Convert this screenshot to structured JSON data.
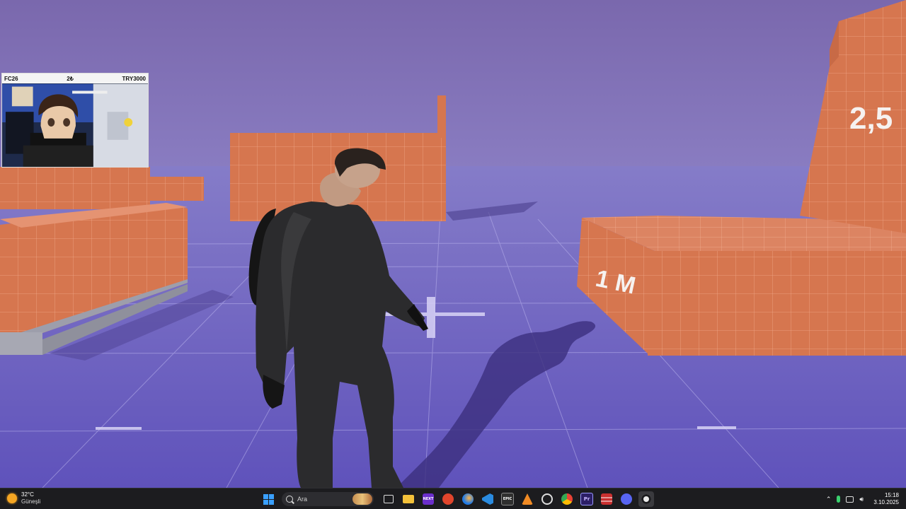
{
  "scene": {
    "label_1m": "1 M",
    "label_25": "2,5"
  },
  "webcam": {
    "left": "FC26",
    "center": "2₺",
    "right": "TRY3000"
  },
  "taskbar": {
    "weather": {
      "temp": "32°C",
      "desc": "Güneşli"
    },
    "search_placeholder": "Ara",
    "apps": [
      {
        "name": "file-explorer",
        "color": "#f3c13a"
      },
      {
        "name": "next",
        "label": "NEXT",
        "color": "#6b2ecb"
      },
      {
        "name": "app-red",
        "color": "#e0452c"
      },
      {
        "name": "firefox",
        "color": "#1f7be8"
      },
      {
        "name": "vscode",
        "color": "#2a8be0"
      },
      {
        "name": "epic-games",
        "label": "EPIC",
        "color": "#2f2f2f"
      },
      {
        "name": "app-orange",
        "color": "#f08a24"
      },
      {
        "name": "app-circle",
        "color": "#3a3a3a"
      },
      {
        "name": "chrome",
        "color": "#e0b534"
      },
      {
        "name": "premiere",
        "label": "Pr",
        "color": "#2c1f66"
      },
      {
        "name": "app-bars",
        "color": "#c93030"
      },
      {
        "name": "discord",
        "color": "#5865f2"
      },
      {
        "name": "unreal",
        "color": "#eaeaea"
      }
    ],
    "time": "15:18",
    "date": "3.10.2025"
  },
  "colors": {
    "sky": "#7b6cb0",
    "floor": "#6a5dbf",
    "wall": "#d6764f",
    "taskbar": "#1c1c1f"
  }
}
